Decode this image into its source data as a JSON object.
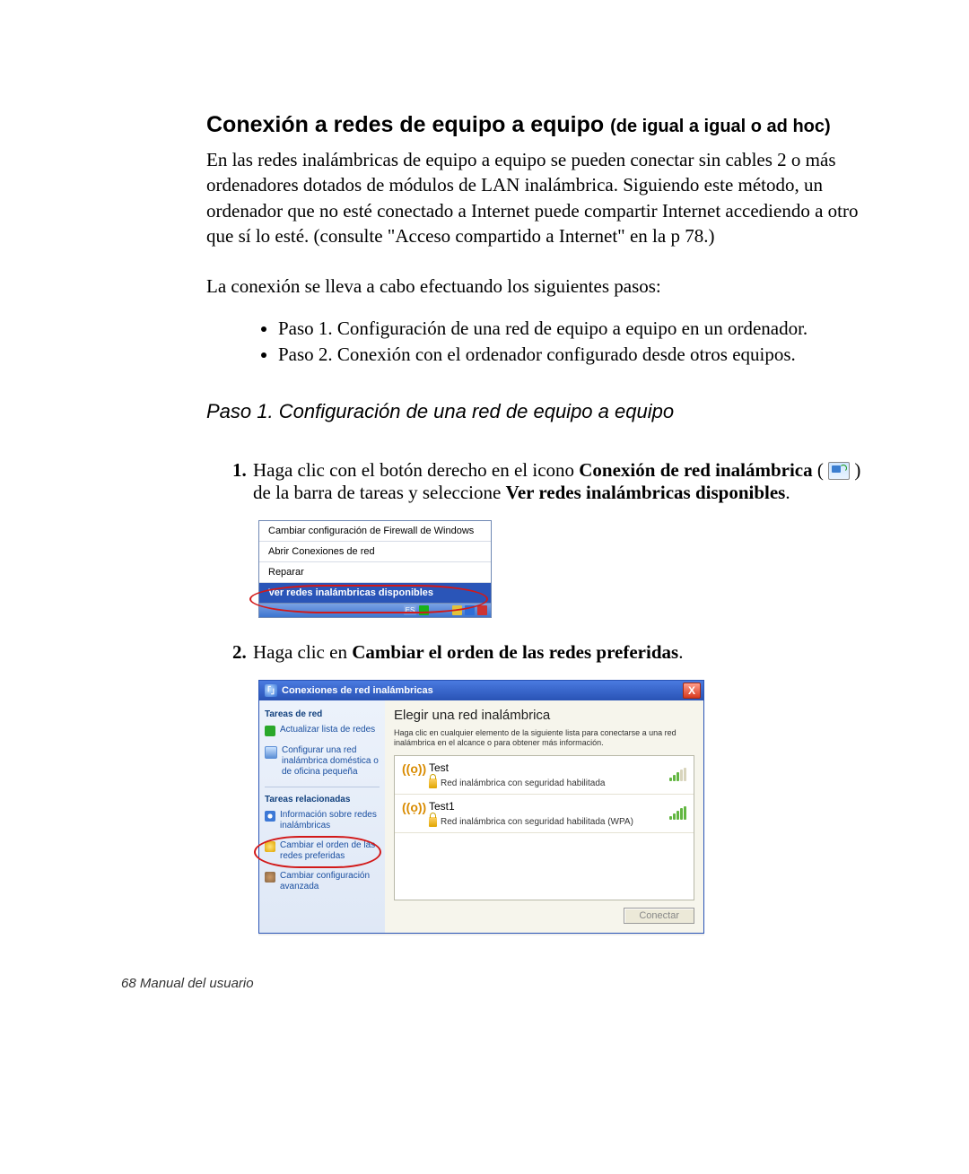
{
  "heading": {
    "main": "Conexión a redes de equipo a equipo ",
    "sub": "(de igual a igual o ad hoc)"
  },
  "intro": "En las redes inalámbricas de equipo a equipo se pueden conectar sin cables 2 o más ordenadores dotados de módulos de LAN inalámbrica. Siguiendo este método, un ordenador que no esté conectado a Internet puede compartir Internet accediendo a otro que sí lo esté. (consulte \"Acceso compartido a Internet\" en la p 78.)",
  "leadin": "La conexión se lleva a cabo efectuando los siguientes pasos:",
  "bullets": [
    "Paso 1. Configuración de una red de equipo a equipo en un ordenador.",
    "Paso 2. Conexión con el ordenador configurado desde otros equipos."
  ],
  "step_heading": "Paso 1. Configuración de una red de equipo a equipo",
  "step1": {
    "pre": "Haga clic con el botón derecho en el icono ",
    "bold1": "Conexión de red inalámbrica",
    "mid": " ( ",
    "post_icon": " ) de la barra de tareas y seleccione ",
    "bold2": "Ver redes inalámbricas disponibles",
    "end": "."
  },
  "ctxmenu": {
    "i1": "Cambiar configuración de Firewall de Windows",
    "i2": "Abrir Conexiones de red",
    "i3": "Reparar",
    "i4": "Ver redes inalámbricas disponibles",
    "es": "ES"
  },
  "step2": {
    "pre": "Haga clic en ",
    "bold": "Cambiar el orden de las redes preferidas",
    "end": "."
  },
  "wlan": {
    "title": "Conexiones de red inalámbricas",
    "close": "X",
    "side": {
      "h1": "Tareas de red",
      "i1": "Actualizar lista de redes",
      "i2": "Configurar una red inalámbrica doméstica o de oficina pequeña",
      "h2": "Tareas relacionadas",
      "i3": "Información sobre redes inalámbricas",
      "i4": "Cambiar el orden de las redes preferidas",
      "i5": "Cambiar configuración avanzada"
    },
    "main": {
      "h": "Elegir una red inalámbrica",
      "hint": "Haga clic en cualquier elemento de la siguiente lista para conectarse a una red inalámbrica en el alcance o para obtener más información.",
      "net1": {
        "name": "Test",
        "sub": "Red inalámbrica con seguridad habilitada"
      },
      "net2": {
        "name": "Test1",
        "sub": "Red inalámbrica con seguridad habilitada (WPA)"
      },
      "connect": "Conectar"
    }
  },
  "footer": {
    "page": "68",
    "label": "  Manual del usuario"
  }
}
